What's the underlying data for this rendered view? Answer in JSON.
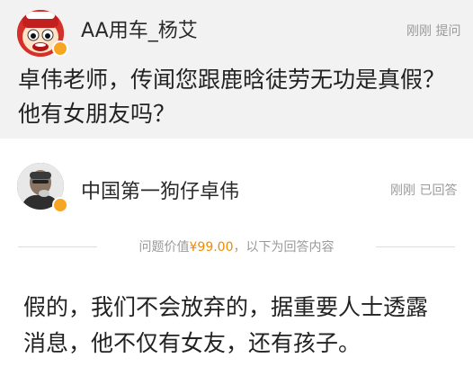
{
  "question": {
    "username": "AA用车_杨艾",
    "meta": "刚刚 提问",
    "line1": "卓伟老师，传闻您跟鹿晗徒劳无功是真假？",
    "line2": "他有女朋友吗？"
  },
  "answer": {
    "username": "中国第一狗仔卓伟",
    "meta": "刚刚 已回答",
    "divider_prefix": "问题价值",
    "price": "¥99.00",
    "divider_suffix": "，以下为回答内容",
    "line1": "假的，我们不会放弃的，据重要人士透露",
    "line2": "消息，他不仅有女友，还有孩子。"
  },
  "colors": {
    "price": "#f08a00",
    "badge": "#f6a623",
    "question_bg": "#f2f2f2"
  },
  "icons": {
    "question_avatar": "cartoon-face-avatar-icon",
    "answer_avatar": "person-photo-avatar-icon",
    "verified": "verified-v-badge-icon"
  }
}
